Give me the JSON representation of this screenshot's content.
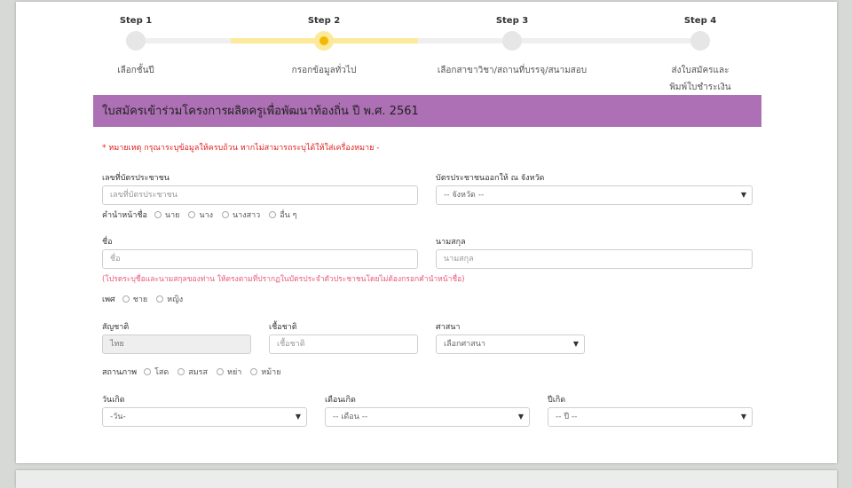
{
  "steps": [
    {
      "title": "Step 1",
      "label": "เลือกชั้นปี"
    },
    {
      "title": "Step 2",
      "label": "กรอกข้อมูลทั่วไป"
    },
    {
      "title": "Step 3",
      "label": "เลือกสาขาวิชา/สถานที่บรรจุ/สนามสอบ"
    },
    {
      "title": "Step 4",
      "label": "ส่งใบสมัครและ\nพิมพ์ใบชำระเงิน"
    }
  ],
  "colors": {
    "header": "#ad70b4",
    "active_step": "#f3b900",
    "note": "#e32020"
  },
  "form": {
    "title": "ใบสมัครเข้าร่วมโครงการผลิตครูเพื่อพัฒนาท้องถิ่น ปี พ.ศ. 2561",
    "note": "* หมายเหตุ กรุณาระบุข้อมูลให้ครบถ้วน หากไม่สามารถระบุได้ให้ใส่เครื่องหมาย -",
    "id_card": {
      "label": "เลขที่บัตรประชาชน",
      "placeholder": "เลขที่บัตรประชาชน"
    },
    "province": {
      "label": "บัตรประชาชนออกให้ ณ จังหวัด",
      "value": "-- จังหวัด --"
    },
    "prefix": {
      "label": "คำนำหน้าชื่อ",
      "options": [
        "นาย",
        "นาง",
        "นางสาว",
        "อื่น ๆ"
      ]
    },
    "first_name": {
      "label": "ชื่อ",
      "placeholder": "ชื่อ"
    },
    "last_name": {
      "label": "นามสกุล",
      "placeholder": "นามสกุล"
    },
    "name_hint": "(โปรดระบุชื่อและนามสกุลของท่าน ให้ตรงตามที่ปรากฏในบัตรประจำตัวประชาชนโดยไม่ต้องกรอกคำนำหน้าชื่อ)",
    "gender": {
      "label": "เพศ",
      "options": [
        "ชาย",
        "หญิง"
      ]
    },
    "nationality": {
      "label": "สัญชาติ",
      "value": "ไทย"
    },
    "ethnicity": {
      "label": "เชื้อชาติ",
      "placeholder": "เชื้อชาติ"
    },
    "religion": {
      "label": "ศาสนา",
      "value": "เลือกศาสนา"
    },
    "marital": {
      "label": "สถานภาพ",
      "options": [
        "โสด",
        "สมรส",
        "หย่า",
        "หม้าย"
      ]
    },
    "birth_day": {
      "label": "วันเกิด",
      "value": "-วัน-"
    },
    "birth_month": {
      "label": "เดือนเกิด",
      "value": "-- เดือน --"
    },
    "birth_year": {
      "label": "ปีเกิด",
      "value": "-- ปี --"
    }
  }
}
